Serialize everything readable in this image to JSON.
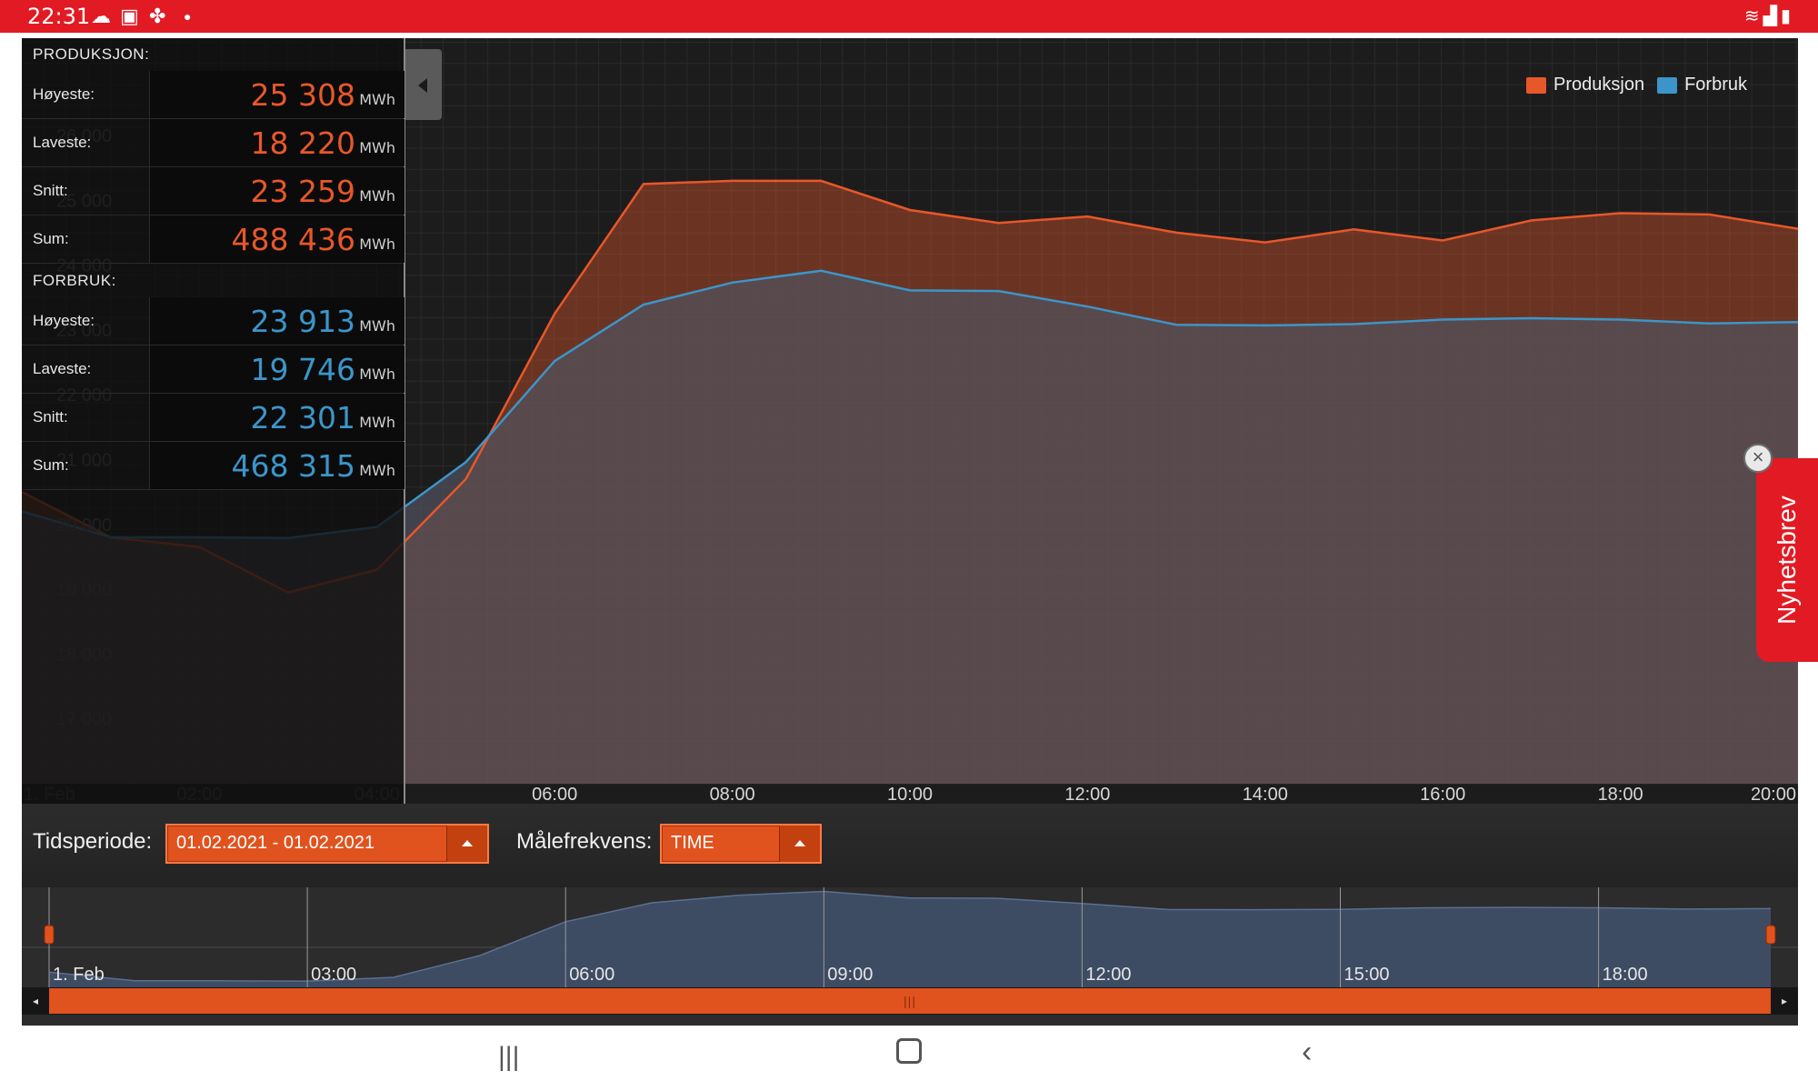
{
  "status_bar": {
    "time": "22:31",
    "left_icons": [
      "cloud-icon",
      "screenshot-icon",
      "fan-icon",
      "dot-icon"
    ],
    "right_icons": [
      "wifi-icon",
      "signal-icon",
      "battery-icon"
    ]
  },
  "stats": {
    "produksjon": {
      "title": "PRODUKSJON:",
      "rows": [
        {
          "label": "Høyeste:",
          "value": "25 308",
          "unit": "MWh"
        },
        {
          "label": "Laveste:",
          "value": "18 220",
          "unit": "MWh"
        },
        {
          "label": "Snitt:",
          "value": "23 259",
          "unit": "MWh"
        },
        {
          "label": "Sum:",
          "value": "488 436",
          "unit": "MWh"
        }
      ]
    },
    "forbruk": {
      "title": "FORBRUK:",
      "rows": [
        {
          "label": "Høyeste:",
          "value": "23 913",
          "unit": "MWh"
        },
        {
          "label": "Laveste:",
          "value": "19 746",
          "unit": "MWh"
        },
        {
          "label": "Snitt:",
          "value": "22 301",
          "unit": "MWh"
        },
        {
          "label": "Sum:",
          "value": "468 315",
          "unit": "MWh"
        }
      ]
    }
  },
  "legend": {
    "produksjon": "Produksjon",
    "forbruk": "Forbruk"
  },
  "controls": {
    "period_label": "Tidsperiode:",
    "period_value": "01.02.2021 - 01.02.2021",
    "freq_label": "Målefrekvens:",
    "freq_value": "TIME"
  },
  "newsletter": {
    "label": "Nyhetsbrev"
  },
  "colors": {
    "produksjon": "#e8572a",
    "forbruk": "#3c95c9",
    "accent": "#e21a23",
    "scroll": "#e0531f"
  },
  "chart_data": {
    "type": "area",
    "x": [
      "00:00",
      "01:00",
      "02:00",
      "03:00",
      "04:00",
      "05:00",
      "06:00",
      "07:00",
      "08:00",
      "09:00",
      "10:00",
      "11:00",
      "12:00",
      "13:00",
      "14:00",
      "15:00",
      "16:00",
      "17:00",
      "18:00",
      "19:00",
      "20:00"
    ],
    "x_ticks": [
      "1. Feb",
      "02:00",
      "04:00",
      "06:00",
      "08:00",
      "10:00",
      "12:00",
      "14:00",
      "16:00",
      "18:00",
      "20:00"
    ],
    "y_ticks": [
      "17 000",
      "18 000",
      "19 000",
      "20 000",
      "21 000",
      "22 000",
      "23 000",
      "24 000",
      "25 000",
      "26 000"
    ],
    "ylim": [
      16000,
      27500
    ],
    "series": [
      {
        "name": "Produksjon",
        "values": [
          20500,
          19800,
          19650,
          18950,
          19300,
          20700,
          23250,
          25250,
          25300,
          25300,
          24850,
          24650,
          24750,
          24500,
          24350,
          24550,
          24380,
          24690,
          24800,
          24780,
          24560
        ]
      },
      {
        "name": "Forbruk",
        "values": [
          20200,
          19800,
          19800,
          19790,
          19960,
          20960,
          22520,
          23390,
          23730,
          23913,
          23610,
          23600,
          23360,
          23080,
          23070,
          23090,
          23160,
          23180,
          23160,
          23100,
          23120
        ]
      }
    ],
    "navigator": {
      "x_ticks": [
        "1. Feb",
        "03:00",
        "06:00",
        "09:00",
        "12:00",
        "15:00",
        "18:00"
      ]
    }
  }
}
